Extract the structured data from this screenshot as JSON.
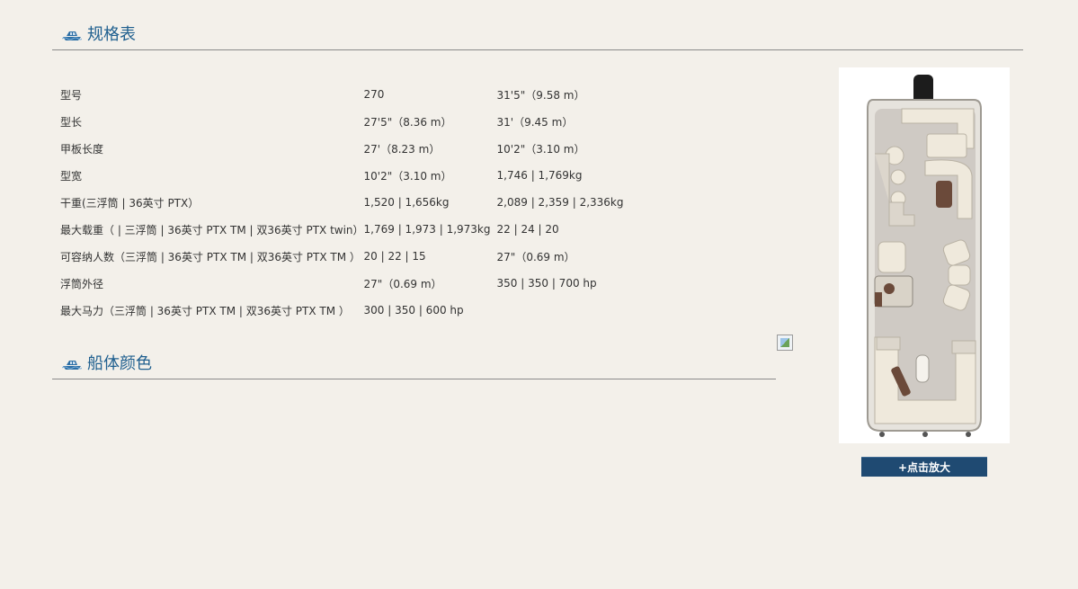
{
  "specs_section": {
    "title": "规格表",
    "rows": [
      {
        "label": "型号",
        "value_a": "270",
        "value_b": "31'5\"（9.58 m）"
      },
      {
        "label": "型长",
        "value_a": "27'5\"（8.36 m）",
        "value_b": "31'（9.45 m）"
      },
      {
        "label": "甲板长度",
        "value_a": "27'（8.23 m）",
        "value_b": "10'2\"（3.10 m）"
      },
      {
        "label": "型宽",
        "value_a": "10'2\"（3.10 m）",
        "value_b": "1,746 | 1,769kg"
      },
      {
        "label": "干重(三浮筒 | 36英寸 PTX）",
        "value_a": "1,520 | 1,656kg",
        "value_b": "2,089 | 2,359 | 2,336kg"
      },
      {
        "label": "最大载重（ | 三浮筒 | 36英寸 PTX TM | 双36英寸 PTX twin）",
        "value_a": "1,769 | 1,973 | 1,973kg",
        "value_b": "22 | 24 | 20"
      },
      {
        "label": "可容纳人数（三浮筒 | 36英寸 PTX TM | 双36英寸 PTX TM ）",
        "value_a": "20 | 22 | 15",
        "value_b": "27\"（0.69 m）"
      },
      {
        "label": "浮筒外径",
        "value_a": "27\"（0.69 m）",
        "value_b": "350 | 350 | 700 hp"
      },
      {
        "label": "最大马力（三浮筒 | 36英寸 PTX TM | 双36英寸 PTX TM ）",
        "value_a": "300 | 350 | 600 hp",
        "value_b": ""
      }
    ]
  },
  "colors_section": {
    "title": "船体颜色"
  },
  "zoom_button": {
    "label": "+点击放大"
  },
  "icons": {
    "section_icon": "boat-icon",
    "broken_image": "broken-image-icon"
  },
  "colors": {
    "title_blue": "#1f5f8f",
    "button_navy": "#1f4a72",
    "background": "#f3f0ea"
  }
}
